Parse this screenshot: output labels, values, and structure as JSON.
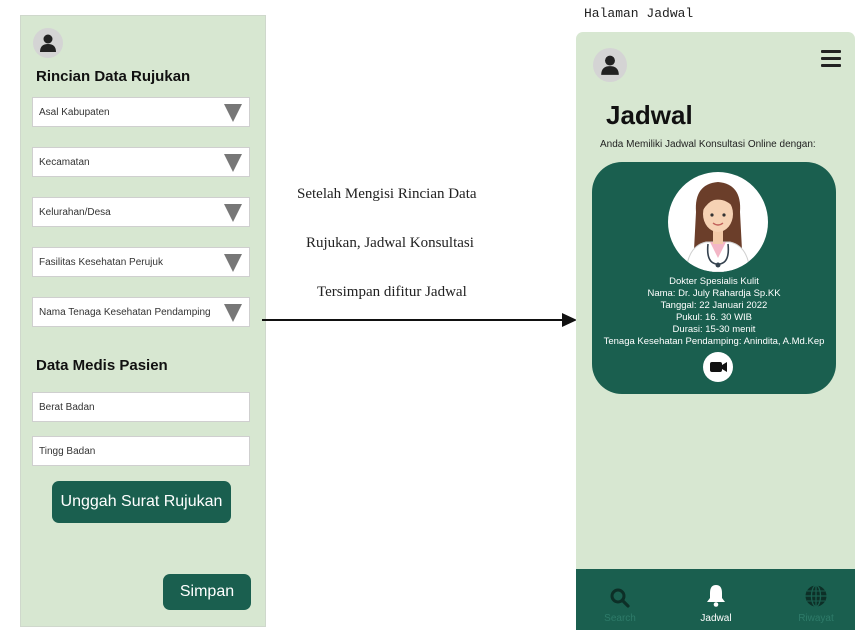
{
  "left_screen": {
    "section1_title": "Rincian Data Rujukan",
    "dropdowns": [
      {
        "label": "Asal Kabupaten"
      },
      {
        "label": "Kecamatan"
      },
      {
        "label": "Kelurahan/Desa"
      },
      {
        "label": "Fasilitas Kesehatan Perujuk"
      },
      {
        "label": "Nama Tenaga Kesehatan Pendamping"
      }
    ],
    "section2_title": "Data Medis Pasien",
    "fields": [
      {
        "label": "Berat Badan"
      },
      {
        "label": "Tingg Badan"
      }
    ],
    "upload_button": "Unggah Surat Rujukan",
    "save_button": "Simpan"
  },
  "caption": {
    "line1": "Setelah Mengisi Rincian Data",
    "line2": "Rujukan, Jadwal Konsultasi",
    "line3": "Tersimpan difitur Jadwal"
  },
  "right_screen": {
    "screen_label": "Halaman Jadwal",
    "title": "Jadwal",
    "subtitle": "Anda Memiliki Jadwal Konsultasi Online dengan:",
    "card": {
      "specialty": "Dokter Spesialis Kulit",
      "name": "Nama: Dr. July Rahardja Sp.KK",
      "date": "Tanggal: 22 Januari 2022",
      "time": "Pukul: 16. 30 WIB",
      "duration": "Durasi: 15-30 menit",
      "companion": "Tenaga Kesehatan Pendamping:  Anindita, A.Md.Kep"
    },
    "nav": [
      {
        "label": "Search",
        "icon": "search-icon"
      },
      {
        "label": "Jadwal",
        "icon": "bell-icon"
      },
      {
        "label": "Riwayat",
        "icon": "globe-icon"
      }
    ]
  },
  "colors": {
    "background_panel": "#d7e7d1",
    "accent_dark_green": "#1a5f4f",
    "nav_inactive": "#2e7b69"
  }
}
